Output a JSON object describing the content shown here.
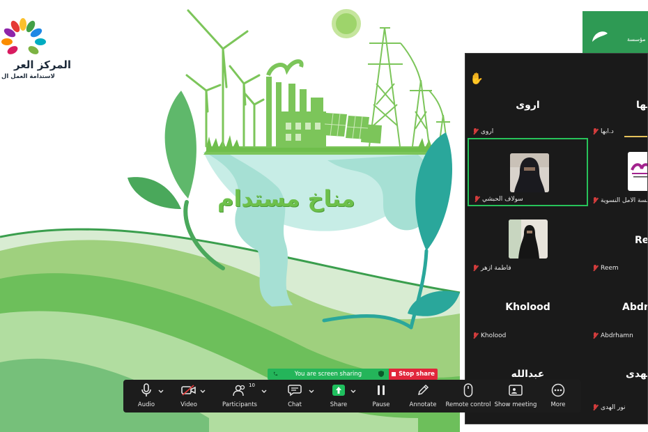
{
  "slide": {
    "org_name": "المركز العر",
    "org_subtitle": "لاستدامة العمل ال",
    "title": "مناخ مستدام",
    "corner_logo_text": "مؤسسة",
    "colors": {
      "green_primary": "#6dc04b",
      "green_dark": "#2e9a54",
      "teal": "#2aa79b",
      "globe_light": "#c7ede6"
    }
  },
  "gallery": {
    "raise_hand_icon": "✋",
    "tiles": [
      {
        "name": "اروى",
        "label": "اروى",
        "type": "name"
      },
      {
        "name": "د.ابها",
        "label": "د.ابها",
        "type": "name",
        "display": "ابها"
      },
      {
        "name": "",
        "label": "سولاف الحبشي",
        "type": "video",
        "active": true
      },
      {
        "name": "",
        "label": "مؤسسة الامل النسوية",
        "type": "logo"
      },
      {
        "name": "",
        "label": "فاطمة ازهر",
        "type": "video"
      },
      {
        "name": "Reem",
        "label": "Reem",
        "type": "name"
      },
      {
        "name": "Kholood",
        "label": "Kholood",
        "type": "name"
      },
      {
        "name": "Abdrhamn",
        "label": "Abdrhamn",
        "type": "name",
        "display": "Abdrh"
      },
      {
        "name": "عبدالله",
        "label": "",
        "type": "name"
      },
      {
        "name": "نور الهدى",
        "label": "نور الهدى",
        "type": "name",
        "display": "الهدى"
      }
    ]
  },
  "share_banner": {
    "status": "You are screen sharing",
    "stop_label": "Stop share"
  },
  "toolbar": {
    "participant_count": "10",
    "items": [
      {
        "label": "Audio",
        "icon": "microphone-icon"
      },
      {
        "label": "Video",
        "icon": "video-off-icon"
      },
      {
        "label": "Participants",
        "icon": "participants-icon"
      },
      {
        "label": "Chat",
        "icon": "chat-icon"
      },
      {
        "label": "Share",
        "icon": "share-icon"
      },
      {
        "label": "Pause",
        "icon": "pause-icon"
      },
      {
        "label": "Annotate",
        "icon": "pencil-icon"
      },
      {
        "label": "Remote control",
        "icon": "mouse-icon"
      },
      {
        "label": "Show meeting",
        "icon": "monitor-icon"
      },
      {
        "label": "More",
        "icon": "more-icon"
      }
    ]
  }
}
